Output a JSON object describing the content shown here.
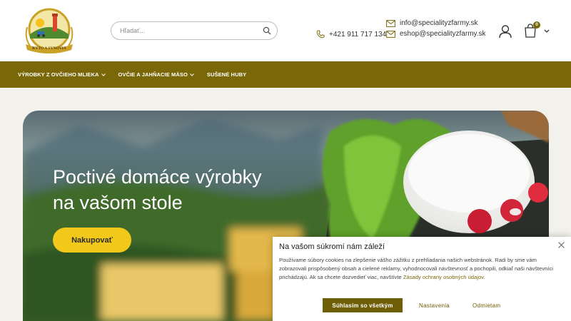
{
  "brand": {
    "logo_text": "KYTO A SYNOVIA"
  },
  "search": {
    "placeholder": "Hľadať..."
  },
  "contact": {
    "phone": "+421 911 717 134",
    "email_info": "info@specialityzfarmy.sk",
    "email_shop": "eshop@specialityzfarmy.sk"
  },
  "cart": {
    "count": "0"
  },
  "nav": {
    "items": [
      {
        "label": "VÝROBKY Z OVČIEHO MLIEKA",
        "has_dropdown": true
      },
      {
        "label": "OVČIE A JAHŇACIE MÄSO",
        "has_dropdown": true
      },
      {
        "label": "SUŠENÉ HUBY",
        "has_dropdown": false
      }
    ]
  },
  "hero": {
    "title_line1": "Poctivé domáce výrobky",
    "title_line2": "na vašom stole",
    "cta_label": "Nakupovať"
  },
  "cookie": {
    "title": "Na vašom súkromí nám záleží",
    "text": "Používame súbory cookies na zlepšenie vášho zážitku z prehliadania našich webstránok. Radi by sme vám zobrazovali prispôsobený obsah a cielené reklamy, vyhodnocovali návštevnosť a pochopili, odkiaľ naši návštevníci prichádzajú. Ak sa chcete dozvedieť viac, navštívte",
    "link_text": "Zásady ochrany osobných údajov",
    "link_suffix": ".",
    "accept_label": "Súhlasím so všetkým",
    "settings_label": "Nastavenia",
    "reject_label": "Odmietam"
  },
  "icons": {
    "search": "search-icon",
    "phone": "phone-icon",
    "mail": "mail-icon",
    "user": "user-icon",
    "cart": "cart-icon",
    "chevron": "chevron-down-icon",
    "close": "close-icon"
  },
  "colors": {
    "brand_olive": "#7a6808",
    "cta_yellow": "#f2c81a",
    "header_bg": "#ffffff",
    "page_bg": "#f3f1ec"
  }
}
